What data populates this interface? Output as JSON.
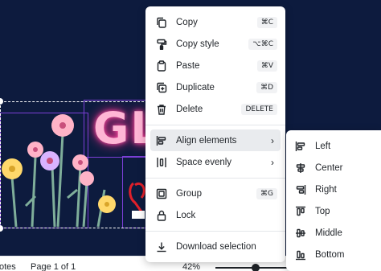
{
  "context_menu": {
    "items": [
      {
        "label": "Copy",
        "shortcut": "⌘C",
        "icon": "copy-icon"
      },
      {
        "label": "Copy style",
        "shortcut": "⌥⌘C",
        "icon": "paint-roller-icon"
      },
      {
        "label": "Paste",
        "shortcut": "⌘V",
        "icon": "clipboard-icon"
      },
      {
        "label": "Duplicate",
        "shortcut": "⌘D",
        "icon": "duplicate-icon"
      },
      {
        "label": "Delete",
        "shortcut": "DELETE",
        "icon": "trash-icon"
      },
      {
        "label": "Align elements",
        "icon": "align-icon",
        "has_submenu": true,
        "active": true
      },
      {
        "label": "Space evenly",
        "icon": "space-evenly-icon",
        "has_submenu": true
      },
      {
        "label": "Group",
        "shortcut": "⌘G",
        "icon": "group-icon"
      },
      {
        "label": "Lock",
        "icon": "lock-icon"
      },
      {
        "label": "Download selection",
        "icon": "download-icon"
      }
    ]
  },
  "align_submenu": {
    "items": [
      {
        "label": "Left",
        "icon": "align-left-icon"
      },
      {
        "label": "Center",
        "icon": "align-center-icon"
      },
      {
        "label": "Right",
        "icon": "align-right-icon"
      },
      {
        "label": "Top",
        "icon": "align-top-icon"
      },
      {
        "label": "Middle",
        "icon": "align-middle-icon"
      },
      {
        "label": "Bottom",
        "icon": "align-bottom-icon"
      }
    ]
  },
  "canvas": {
    "glow_text": "GLO",
    "background_color": "#0d1b3e",
    "frame_color": "#7b3fd6",
    "glow_color": "#ff4fa3"
  },
  "status_bar": {
    "notes_label": "otes",
    "page_label": "Page 1 of 1",
    "zoom_label": "42%",
    "zoom_percent": 42
  }
}
